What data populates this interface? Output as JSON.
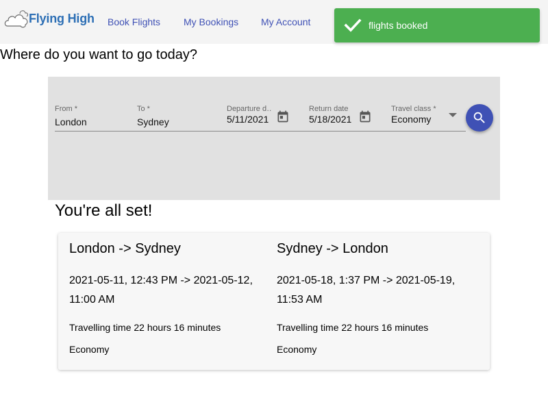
{
  "app": {
    "brand": "Flying High",
    "colors": {
      "header_bg": "#f4f4f4",
      "nav_link": "#3f51b5",
      "brand_text": "#2d6fb5",
      "toast_bg": "#4caf50",
      "search_button": "#3f51b5",
      "panel_bg": "#e1e1e1"
    }
  },
  "nav": {
    "items": [
      {
        "label": "Book Flights"
      },
      {
        "label": "My Bookings"
      },
      {
        "label": "My Account"
      }
    ]
  },
  "toast": {
    "icon": "check-icon",
    "message": "flights booked"
  },
  "page": {
    "heading": "Where do you want to go today?"
  },
  "search": {
    "from": {
      "label": "From *",
      "value": "London"
    },
    "to": {
      "label": "To *",
      "value": "Sydney"
    },
    "departure": {
      "label": "Departure d…",
      "value": "5/11/2021",
      "icon": "calendar-icon"
    },
    "return": {
      "label": "Return date",
      "value": "5/18/2021",
      "icon": "calendar-icon"
    },
    "travel_class": {
      "label": "Travel class *",
      "value": "Economy",
      "icon": "dropdown-arrow-icon"
    },
    "button_icon": "search-icon"
  },
  "result": {
    "heading": "You're all set!",
    "legs": [
      {
        "route": "London -> Sydney",
        "times": "2021-05-11, 12:43 PM -> 2021-05-12, 11:00 AM",
        "duration": "Travelling time 22 hours 16 minutes",
        "class": "Economy"
      },
      {
        "route": "Sydney -> London",
        "times": "2021-05-18, 1:37 PM -> 2021-05-19, 11:53 AM",
        "duration": "Travelling time 22 hours 16 minutes",
        "class": "Economy"
      }
    ]
  }
}
